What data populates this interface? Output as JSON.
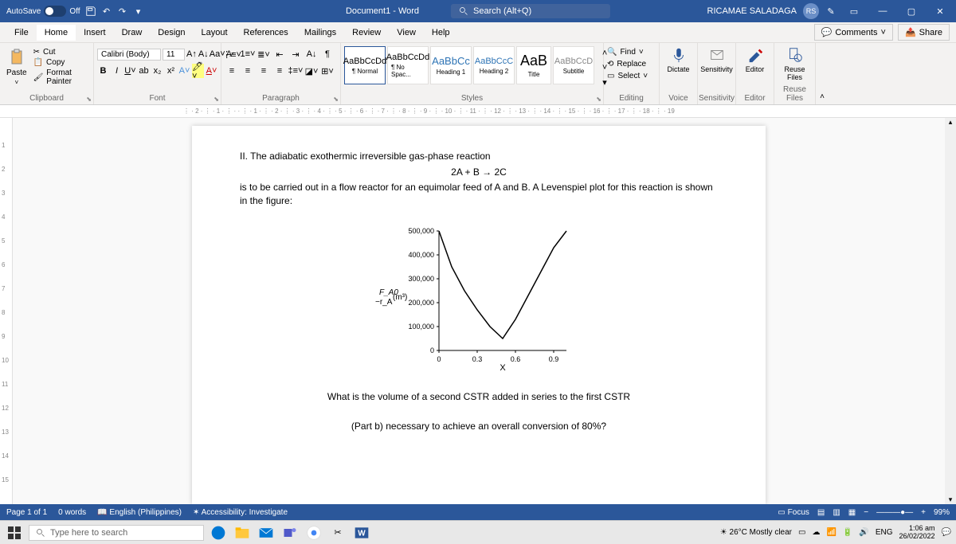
{
  "titlebar": {
    "autosave_label": "AutoSave",
    "autosave_state": "Off",
    "doc_title": "Document1 - Word",
    "search_placeholder": "Search (Alt+Q)",
    "user_name": "RICAMAE SALADAGA",
    "user_initials": "RS"
  },
  "menu": {
    "items": [
      "File",
      "Home",
      "Insert",
      "Draw",
      "Design",
      "Layout",
      "References",
      "Mailings",
      "Review",
      "View",
      "Help"
    ],
    "active": "Home",
    "comments": "Comments",
    "share": "Share"
  },
  "ribbon": {
    "clipboard": {
      "label": "Clipboard",
      "paste": "Paste",
      "cut": "Cut",
      "copy": "Copy",
      "format_painter": "Format Painter"
    },
    "font": {
      "label": "Font",
      "family": "Calibri (Body)",
      "size": "11"
    },
    "paragraph": {
      "label": "Paragraph"
    },
    "styles": {
      "label": "Styles",
      "items": [
        {
          "preview": "AaBbCcDd",
          "name": "¶ Normal",
          "selected": true
        },
        {
          "preview": "AaBbCcDd",
          "name": "¶ No Spac...",
          "selected": false
        },
        {
          "preview": "AaBbCc",
          "name": "Heading 1",
          "selected": false
        },
        {
          "preview": "AaBbCcC",
          "name": "Heading 2",
          "selected": false
        },
        {
          "preview": "AaB",
          "name": "Title",
          "selected": false
        },
        {
          "preview": "AaBbCcD",
          "name": "Subtitle",
          "selected": false
        }
      ]
    },
    "editing": {
      "label": "Editing",
      "find": "Find",
      "replace": "Replace",
      "select": "Select"
    },
    "voice": {
      "label": "Voice",
      "dictate": "Dictate"
    },
    "sensitivity": {
      "label": "Sensitivity",
      "btn": "Sensitivity"
    },
    "editor": {
      "label": "Editor",
      "btn": "Editor"
    },
    "reuse": {
      "label": "Reuse Files",
      "btn": "Reuse\nFiles"
    }
  },
  "document": {
    "line1": "II. The adiabatic exothermic irreversible gas-phase reaction",
    "equation": "2A + B → 2C",
    "line2": "is to be carried out in a flow reactor for an equimolar feed of A and B. A Levenspiel plot for this reaction is shown in the figure:",
    "ylabel_top": "F_A0",
    "ylabel_bot": "−r_A",
    "ylabel_unit": "(m³)",
    "xlabel": "X",
    "question1": "What is the volume of a second CSTR added in series to the first CSTR",
    "question2": "(Part b) necessary to achieve an overall conversion of 80%?"
  },
  "chart_data": {
    "type": "line",
    "title": "",
    "xlabel": "X",
    "ylabel": "F_A0 / -r_A (m³)",
    "xlim": [
      0,
      1
    ],
    "ylim": [
      0,
      500000
    ],
    "x_ticks": [
      0,
      0.3,
      0.6,
      0.9
    ],
    "y_ticks": [
      0,
      100000,
      200000,
      300000,
      400000,
      500000
    ],
    "series": [
      {
        "name": "Levenspiel",
        "x": [
          0.0,
          0.1,
          0.2,
          0.3,
          0.4,
          0.5,
          0.6,
          0.7,
          0.8,
          0.9,
          1.0
        ],
        "values": [
          500000,
          350000,
          250000,
          170000,
          100000,
          50000,
          130000,
          230000,
          330000,
          430000,
          500000
        ]
      }
    ]
  },
  "status": {
    "page": "Page 1 of 1",
    "words": "0 words",
    "lang": "English (Philippines)",
    "accessibility": "Accessibility: Investigate",
    "focus": "Focus",
    "zoom": "99%"
  },
  "taskbar": {
    "search_placeholder": "Type here to search",
    "weather": "26°C Mostly clear",
    "lang": "ENG",
    "time": "1:06 am",
    "date": "26/02/2022"
  }
}
